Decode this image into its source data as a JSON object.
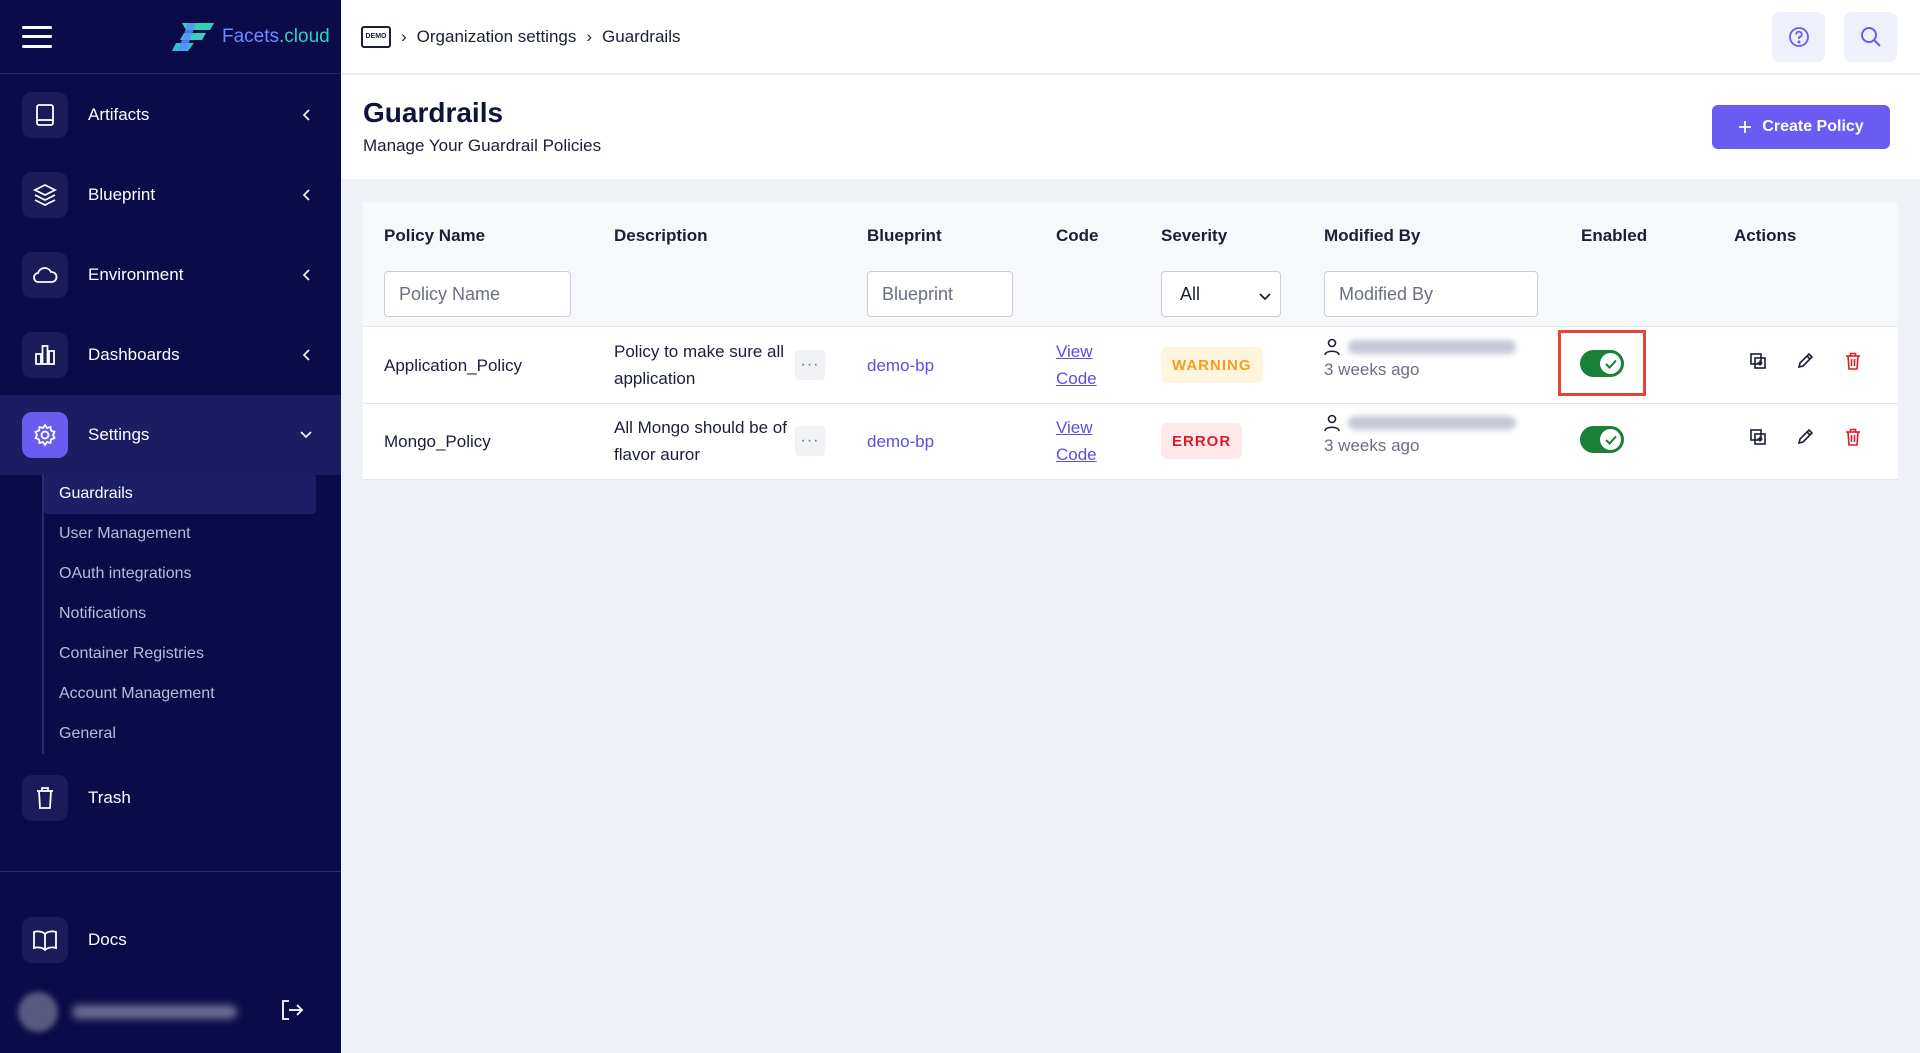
{
  "brand": {
    "name": "Facets",
    "suffix": ".cloud"
  },
  "sidebar": {
    "items": [
      {
        "label": "Artifacts"
      },
      {
        "label": "Blueprint"
      },
      {
        "label": "Environment"
      },
      {
        "label": "Dashboards"
      },
      {
        "label": "Settings"
      },
      {
        "label": "Trash"
      },
      {
        "label": "Docs"
      }
    ],
    "settings_sub": [
      {
        "label": "Guardrails"
      },
      {
        "label": "User Management"
      },
      {
        "label": "OAuth integrations"
      },
      {
        "label": "Notifications"
      },
      {
        "label": "Container Registries"
      },
      {
        "label": "Account Management"
      },
      {
        "label": "General"
      }
    ]
  },
  "breadcrumb": {
    "badge": "DEMO",
    "org": "Organization settings",
    "current": "Guardrails"
  },
  "header": {
    "title": "Guardrails",
    "subtitle": "Manage Your Guardrail Policies",
    "create_label": "Create Policy"
  },
  "table": {
    "columns": [
      "Policy Name",
      "Description",
      "Blueprint",
      "Code",
      "Severity",
      "Modified By",
      "Enabled",
      "Actions"
    ],
    "filters": {
      "policy_name_placeholder": "Policy Name",
      "blueprint_placeholder": "Blueprint",
      "severity_value": "All",
      "modified_by_placeholder": "Modified By"
    },
    "rows": [
      {
        "name": "Application_Policy",
        "description": "Policy to make sure all application",
        "more": "···",
        "blueprint": "demo-bp",
        "code_line1": "View",
        "code_line2": "Code",
        "severity": "WARNING",
        "modified_time": "3 weeks ago",
        "enabled": true
      },
      {
        "name": "Mongo_Policy",
        "description": "All Mongo should be of flavor auror",
        "more": "···",
        "blueprint": "demo-bp",
        "code_line1": "View",
        "code_line2": "Code",
        "severity": "ERROR",
        "modified_time": "3 weeks ago",
        "enabled": true
      }
    ]
  },
  "colors": {
    "sidebar_bg": "#0b0b4a",
    "accent": "#6a5cf2",
    "toggle_on": "#1a7f37",
    "warning": "#f0a020",
    "error": "#d81e2a",
    "highlight": "#e5423a"
  }
}
